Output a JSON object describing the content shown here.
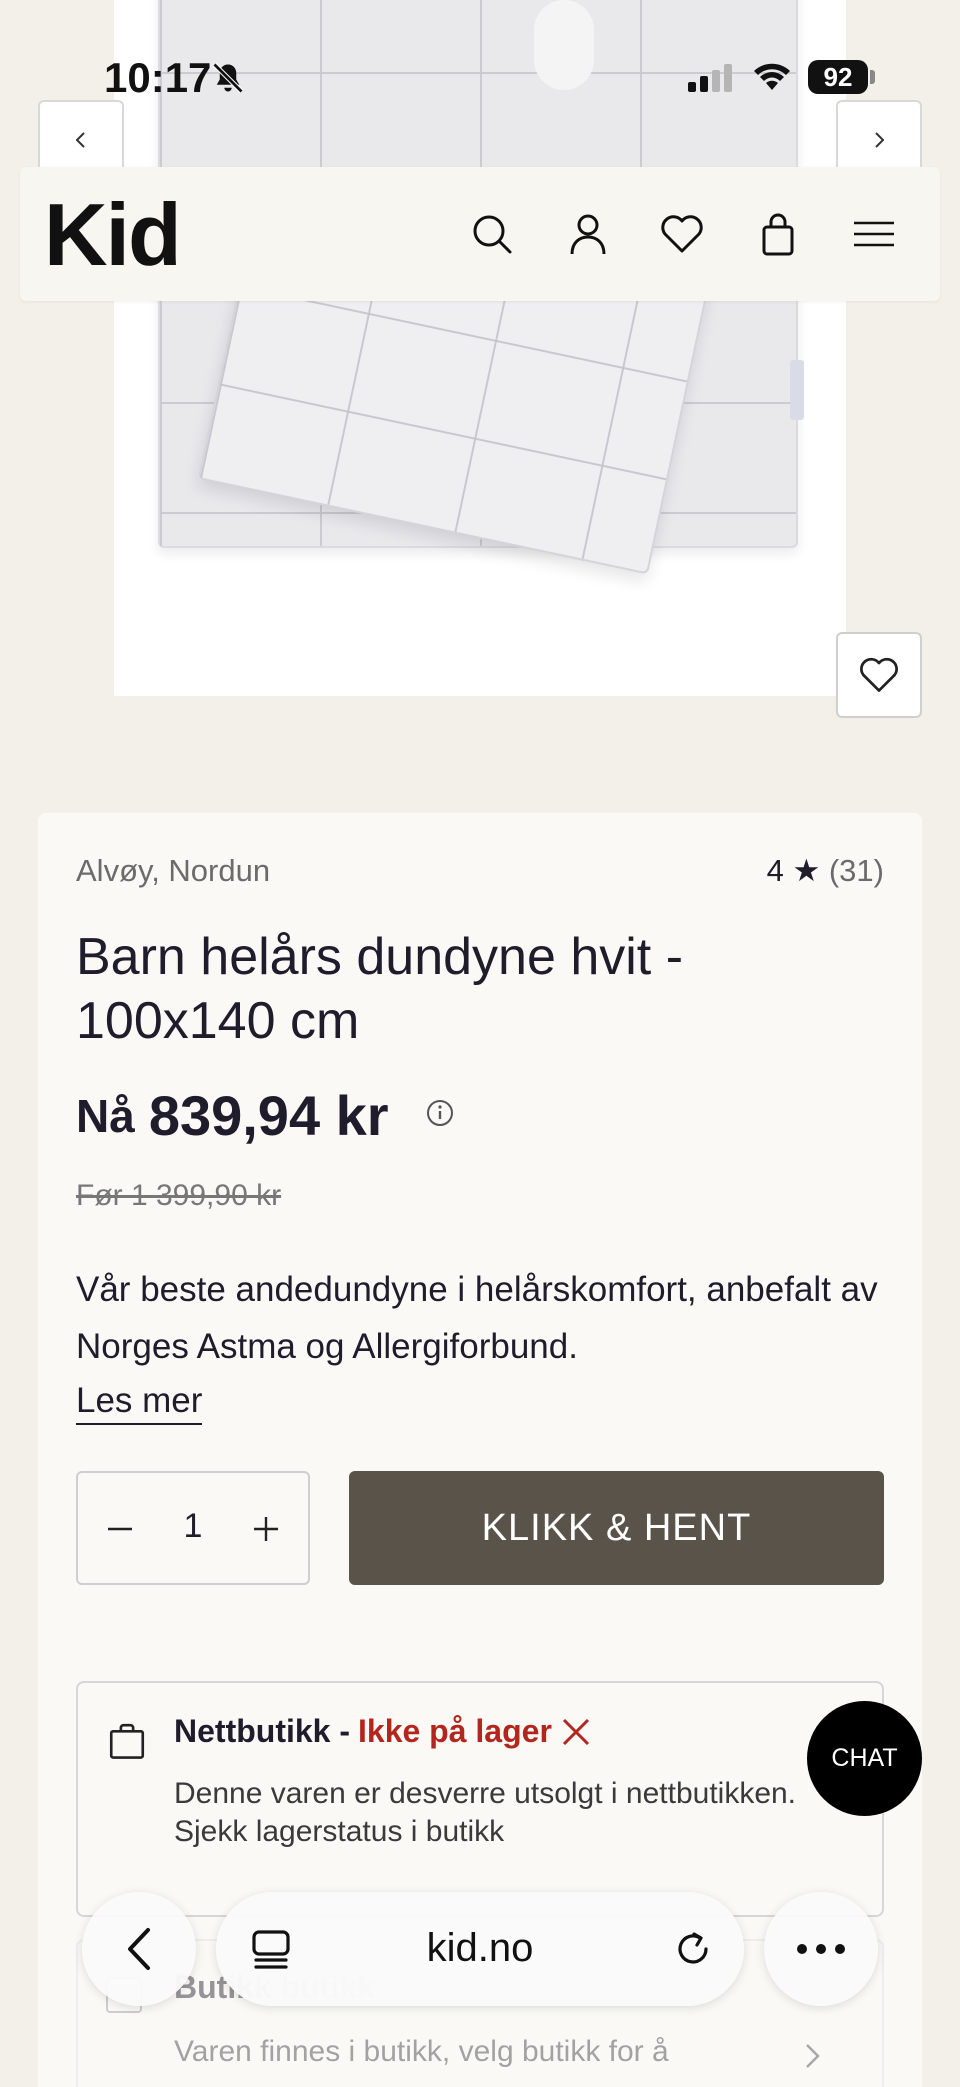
{
  "status_bar": {
    "time": "10:17",
    "battery": "92",
    "icons": [
      "bell-muted-icon",
      "signal-icon",
      "wifi-icon",
      "battery-icon"
    ]
  },
  "header": {
    "logo": "Kid",
    "icons": [
      "search-icon",
      "account-icon",
      "heart-icon",
      "shopping-bag-icon",
      "hamburger-menu-icon"
    ]
  },
  "product": {
    "brand": "Alvøy, Nordun",
    "rating_value": "4",
    "rating_star": "★",
    "rating_count": "(31)",
    "title": "Barn helårs dundyne hvit - 100x140 cm",
    "price_prefix": "Nå",
    "price": "839,94 kr",
    "old_price": "Før 1 399,90 kr",
    "description": "Vår beste andedundyne i helårskomfort, anbefalt av Norges Astma og Allergiforbund.",
    "read_more": "Les mer"
  },
  "cart": {
    "quantity": "1",
    "cta_label": "KLIKK & HENT"
  },
  "stock": {
    "online_label": "Nettbutikk -",
    "online_status": "Ikke på lager",
    "online_text": "Denne varen er desverre utsolgt i nettbutikken. Sjekk lagerstatus i butikk",
    "store_label": "Butikk",
    "store_link": "butikk",
    "store_text": "Varen finnes i butikk, velg butikk for å"
  },
  "chat": {
    "label": "CHAT"
  },
  "browser": {
    "url": "kid.no"
  },
  "colors": {
    "accent_button": "#5a534a",
    "out_of_stock": "#b3261e",
    "page_background": "#f3f0ea"
  }
}
